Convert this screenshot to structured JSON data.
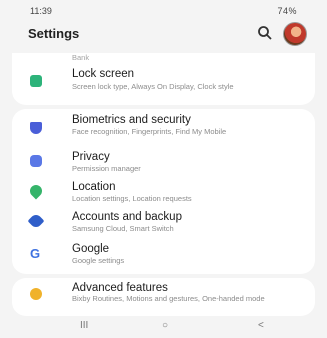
{
  "status_bar": {
    "time": "11:39",
    "right": "74%"
  },
  "header": {
    "title": "Settings"
  },
  "partial_top_item": "Bank",
  "items": [
    {
      "title": "Lock screen",
      "subtitle": "Screen lock type, Always On Display, Clock style",
      "icon": "lock-icon",
      "color": "#2db37a"
    },
    {
      "title": "Biometrics and security",
      "subtitle": "Face recognition, Fingerprints, Find My Mobile",
      "icon": "shield-icon",
      "color": "#4a5ed8"
    },
    {
      "title": "Privacy",
      "subtitle": "Permission manager",
      "icon": "privacy-icon",
      "color": "#5a78e6"
    },
    {
      "title": "Location",
      "subtitle": "Location settings, Location requests",
      "icon": "location-icon",
      "color": "#35b46a"
    },
    {
      "title": "Accounts and backup",
      "subtitle": "Samsung Cloud, Smart Switch",
      "icon": "key-icon",
      "color": "#2f5ec9"
    },
    {
      "title": "Google",
      "subtitle": "Google settings",
      "icon": "google-icon",
      "color": "#3f72e0"
    },
    {
      "title": "Advanced features",
      "subtitle": "Bixby Routines, Motions and gestures, One-handed mode",
      "icon": "gear-plus-icon",
      "color": "#f0b22b"
    }
  ],
  "nav": {
    "recents": "III",
    "home": "○",
    "back": "<"
  }
}
